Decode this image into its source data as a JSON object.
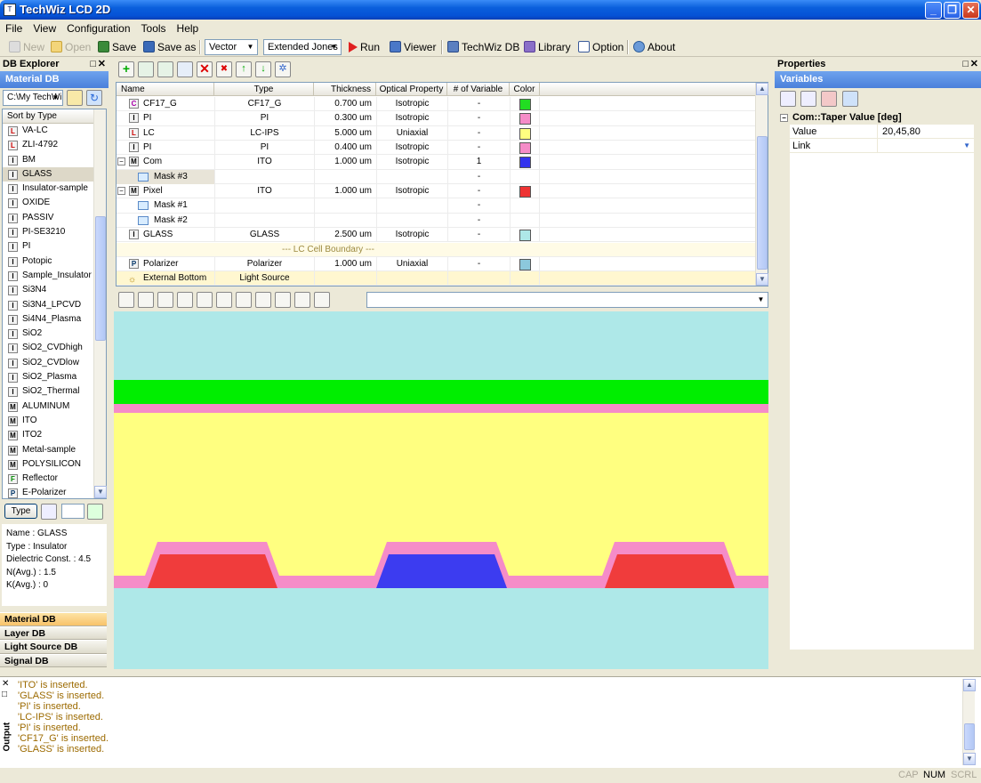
{
  "window": {
    "title": "TechWiz LCD 2D"
  },
  "menu": [
    "File",
    "View",
    "Configuration",
    "Tools",
    "Help"
  ],
  "toolbar": {
    "new": "New",
    "open": "Open",
    "save": "Save",
    "save_as": "Save as",
    "mode": "Vector",
    "method": "Extended Jones",
    "run": "Run",
    "viewer": "Viewer",
    "techwiz_db": "TechWiz DB",
    "library": "Library",
    "option": "Option",
    "about": "About"
  },
  "db_explorer": {
    "title": "DB Explorer",
    "header": "Material DB",
    "path": "C:\\My TechWi",
    "sort_label": "Sort by Type",
    "items": [
      {
        "badge": "L",
        "label": "VA-LC"
      },
      {
        "badge": "L",
        "label": "ZLI-4792"
      },
      {
        "badge": "I",
        "label": "BM"
      },
      {
        "badge": "I",
        "label": "GLASS",
        "selected": true
      },
      {
        "badge": "I",
        "label": "Insulator-sample"
      },
      {
        "badge": "I",
        "label": "OXIDE"
      },
      {
        "badge": "I",
        "label": "PASSIV"
      },
      {
        "badge": "I",
        "label": "PI-SE3210"
      },
      {
        "badge": "I",
        "label": "PI"
      },
      {
        "badge": "I",
        "label": "Potopic"
      },
      {
        "badge": "I",
        "label": "Sample_Insulator"
      },
      {
        "badge": "I",
        "label": "Si3N4"
      },
      {
        "badge": "I",
        "label": "Si3N4_LPCVD"
      },
      {
        "badge": "I",
        "label": "Si4N4_Plasma"
      },
      {
        "badge": "I",
        "label": "SiO2"
      },
      {
        "badge": "I",
        "label": "SiO2_CVDhigh"
      },
      {
        "badge": "I",
        "label": "SiO2_CVDlow"
      },
      {
        "badge": "I",
        "label": "SiO2_Plasma"
      },
      {
        "badge": "I",
        "label": "SiO2_Thermal"
      },
      {
        "badge": "M",
        "label": "ALUMINUM"
      },
      {
        "badge": "M",
        "label": "ITO"
      },
      {
        "badge": "M",
        "label": "ITO2"
      },
      {
        "badge": "M",
        "label": "Metal-sample"
      },
      {
        "badge": "M",
        "label": "POLYSILICON"
      },
      {
        "badge": "F",
        "label": "Reflector"
      },
      {
        "badge": "P",
        "label": "E-Polarizer"
      }
    ],
    "type_button": "Type",
    "info": [
      "Name : GLASS",
      "Type : Insulator",
      "Dielectric Const. : 4.5",
      "N(Avg.) : 1.5",
      "K(Avg.) : 0"
    ],
    "tabs": [
      "Material DB",
      "Layer DB",
      "Light Source DB",
      "Signal DB"
    ]
  },
  "layer_grid": {
    "columns": [
      "Name",
      "Type",
      "Thickness",
      "Optical Property",
      "# of Variable",
      "Color"
    ],
    "rows": [
      {
        "badge": "C",
        "indent": 0,
        "name": "CF17_G",
        "type": "CF17_G",
        "thickness": "0.700 um",
        "optical": "Isotropic",
        "vars": "-",
        "color": "#22dd22"
      },
      {
        "badge": "I",
        "indent": 0,
        "name": "PI",
        "type": "PI",
        "thickness": "0.300 um",
        "optical": "Isotropic",
        "vars": "-",
        "color": "#f58cc8"
      },
      {
        "badge": "L",
        "indent": 0,
        "name": "LC",
        "type": "LC-IPS",
        "thickness": "5.000 um",
        "optical": "Uniaxial",
        "vars": "-",
        "color": "#ffff80"
      },
      {
        "badge": "I",
        "indent": 0,
        "name": "PI",
        "type": "PI",
        "thickness": "0.400 um",
        "optical": "Isotropic",
        "vars": "-",
        "color": "#f58cc8"
      },
      {
        "badge": "M",
        "indent": 0,
        "tree": "−",
        "name": "Com",
        "type": "ITO",
        "thickness": "1.000 um",
        "optical": "Isotropic",
        "vars": "1",
        "color": "#3333ee"
      },
      {
        "badge": "mask",
        "indent": 1,
        "name": "Mask #3",
        "type": "",
        "thickness": "",
        "optical": "",
        "vars": "-",
        "color": "",
        "highlight": true
      },
      {
        "badge": "M",
        "indent": 0,
        "tree": "−",
        "name": "Pixel",
        "type": "ITO",
        "thickness": "1.000 um",
        "optical": "Isotropic",
        "vars": "-",
        "color": "#ee3333"
      },
      {
        "badge": "mask",
        "indent": 1,
        "name": "Mask #1",
        "type": "",
        "thickness": "",
        "optical": "",
        "vars": "-",
        "color": ""
      },
      {
        "badge": "mask",
        "indent": 1,
        "name": "Mask #2",
        "type": "",
        "thickness": "",
        "optical": "",
        "vars": "-",
        "color": ""
      },
      {
        "badge": "I",
        "indent": 0,
        "name": "GLASS",
        "type": "GLASS",
        "thickness": "2.500 um",
        "optical": "Isotropic",
        "vars": "-",
        "color": "#aee8e8"
      },
      {
        "boundary": true,
        "name": "--- LC Cell Boundary ---"
      },
      {
        "badge": "P",
        "indent": 0,
        "name": "Polarizer",
        "type": "Polarizer",
        "thickness": "1.000 um",
        "optical": "Uniaxial",
        "vars": "-",
        "color": "#8cc8dc"
      },
      {
        "badge": "E",
        "indent": 0,
        "name": "External Bottom",
        "type": "Light Source",
        "thickness": "",
        "optical": "",
        "vars": "",
        "color": "",
        "yellow": true
      }
    ]
  },
  "canvas": {
    "colors": {
      "glass": "#aee8e8",
      "cf": "#00ee00",
      "pi": "#f58cc8",
      "lc": "#ffff80",
      "pixel": "#f03c3c",
      "com": "#3c3cf0"
    }
  },
  "properties": {
    "title": "Properties",
    "header": "Variables",
    "group": "Com::Taper Value [deg]",
    "rows": [
      {
        "key": "Value",
        "value": "20,45,80"
      },
      {
        "key": "Link",
        "value": ""
      }
    ]
  },
  "output": {
    "label": "Output",
    "lines": [
      "'ITO' is inserted.",
      "'GLASS' is inserted.",
      "'PI' is inserted.",
      "'LC-IPS' is inserted.",
      "'PI' is inserted.",
      "'CF17_G' is inserted.",
      "'GLASS' is inserted."
    ]
  },
  "status": {
    "cap": "CAP",
    "num": "NUM",
    "scrl": "SCRL"
  }
}
